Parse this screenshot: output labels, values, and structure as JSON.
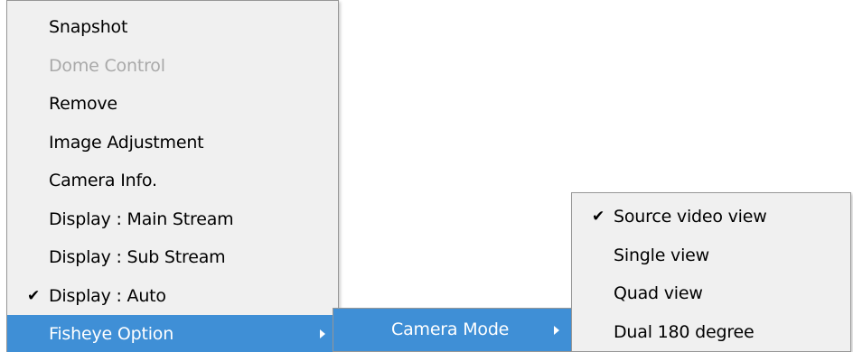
{
  "main_menu": {
    "items": [
      {
        "label": "Snapshot"
      },
      {
        "label": "Dome Control"
      },
      {
        "label": "Remove"
      },
      {
        "label": "Image Adjustment"
      },
      {
        "label": "Camera Info."
      },
      {
        "label": "Display : Main Stream"
      },
      {
        "label": "Display : Sub Stream"
      },
      {
        "label": "Display : Auto",
        "check": "✔"
      },
      {
        "label": "Fisheye Option"
      }
    ]
  },
  "fisheye_submenu": {
    "items": [
      {
        "label": "Camera Mode"
      }
    ]
  },
  "camera_mode_submenu": {
    "items": [
      {
        "label": "Source video view",
        "check": "✔"
      },
      {
        "label": "Single view"
      },
      {
        "label": "Quad view"
      },
      {
        "label": "Dual 180 degree"
      }
    ]
  },
  "colors": {
    "highlight": "#3f8fd6",
    "menu_background": "#f0f0f0",
    "disabled_text": "#a9a9a9",
    "border": "#979797"
  }
}
